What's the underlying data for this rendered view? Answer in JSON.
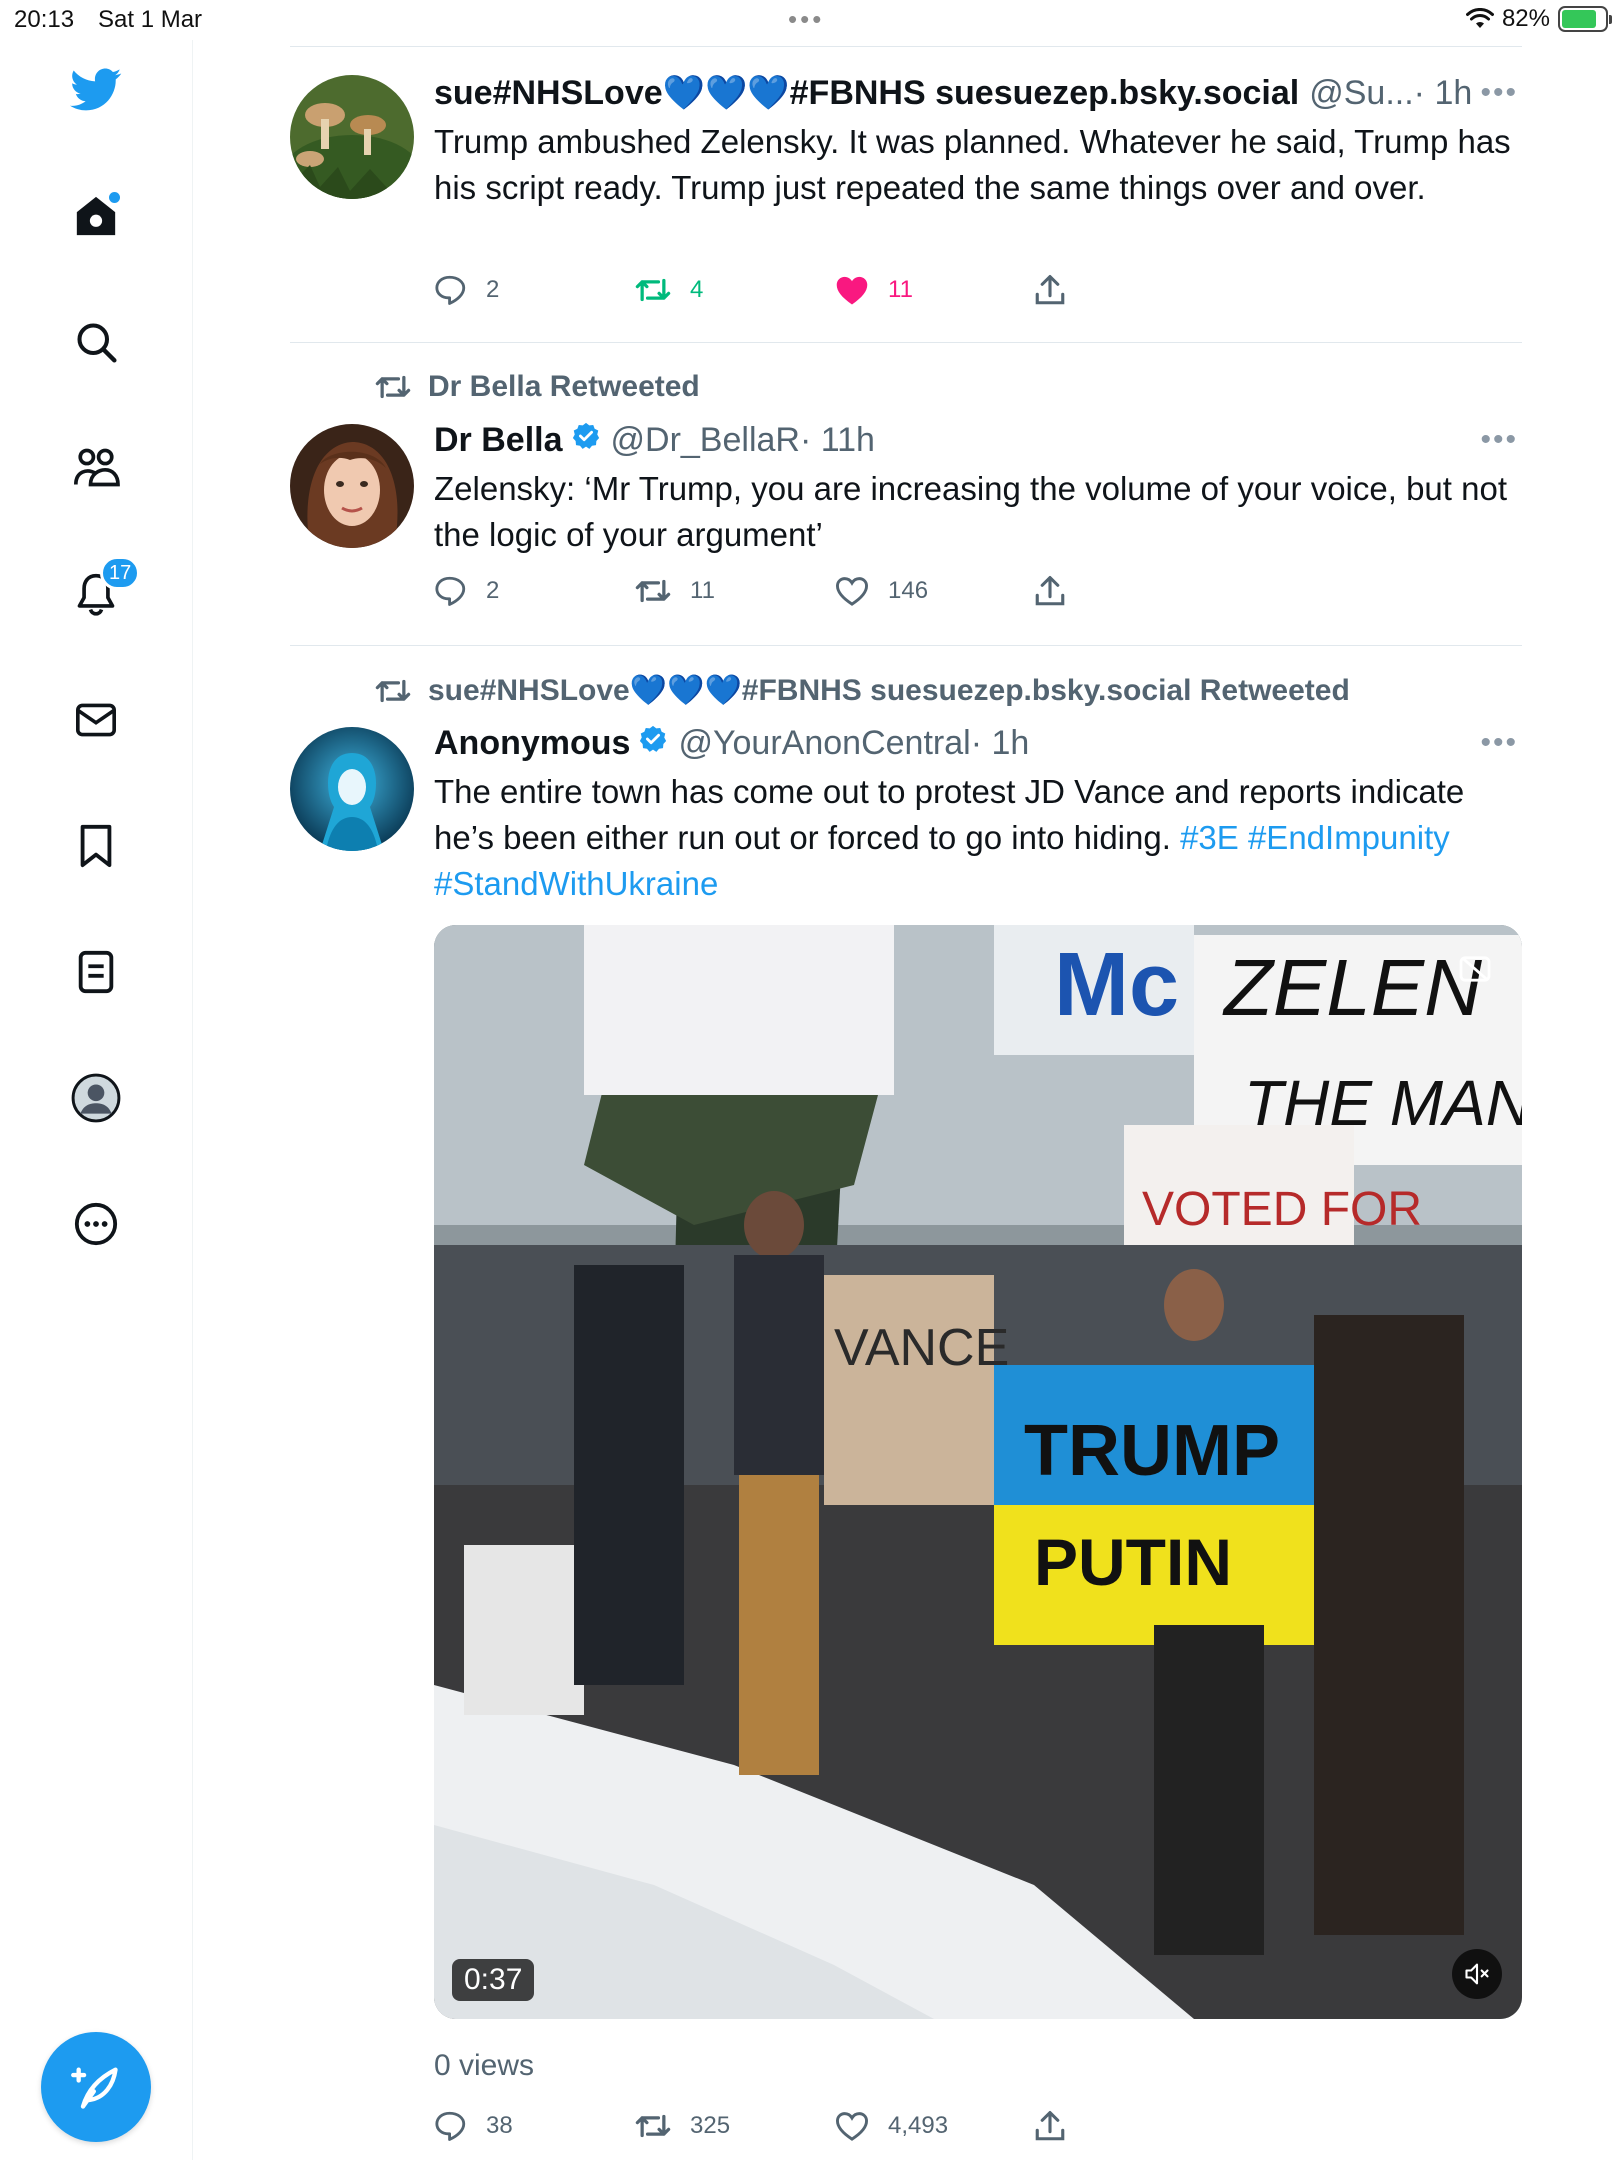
{
  "status_bar": {
    "time": "20:13",
    "date": "Sat 1 Mar",
    "battery_percent": "82%",
    "battery_level": 0.82
  },
  "sidebar": {
    "notifications_count": "17",
    "items": [
      "home",
      "search",
      "communities",
      "notifications",
      "messages",
      "bookmarks",
      "lists",
      "profile",
      "more"
    ]
  },
  "tweets": [
    {
      "name": "sue#NHSLove💙💙💙#FBNHS suesuezep.bsky.social",
      "handle": "@Su...",
      "time": "· 1h",
      "text": "Trump ambushed Zelensky. It was planned.  Whatever he said, Trump has his script ready.  Trump just repeated the same things over and over.",
      "replies": "2",
      "retweets": "4",
      "likes": "11"
    },
    {
      "retweeted_by": "Dr Bella Retweeted",
      "name": "Dr Bella",
      "handle": "@Dr_BellaR",
      "time": "· 11h",
      "text": "Zelensky: ‘Mr Trump, you are increasing the volume of your voice, but not the logic of your argument’",
      "replies": "2",
      "retweets": "11",
      "likes": "146"
    },
    {
      "retweeted_by": "sue#NHSLove💙💙💙#FBNHS suesuezep.bsky.social Retweeted",
      "name": "Anonymous",
      "handle": "@YourAnonCentral",
      "time": "· 1h",
      "text": "The entire town has come out to protest JD Vance and reports indicate he’s been either run out or forced to go into hiding. ",
      "hashtags": [
        "#3E",
        "#EndImpunity",
        "#StandWithUkraine"
      ],
      "video_duration": "0:37",
      "views": "0 views",
      "replies": "38",
      "retweets": "325",
      "likes": "4,493"
    }
  ],
  "colors": {
    "accent": "#1d9bf0",
    "retweet": "#00ba7c",
    "like": "#f91880",
    "muted_text": "#536471"
  }
}
